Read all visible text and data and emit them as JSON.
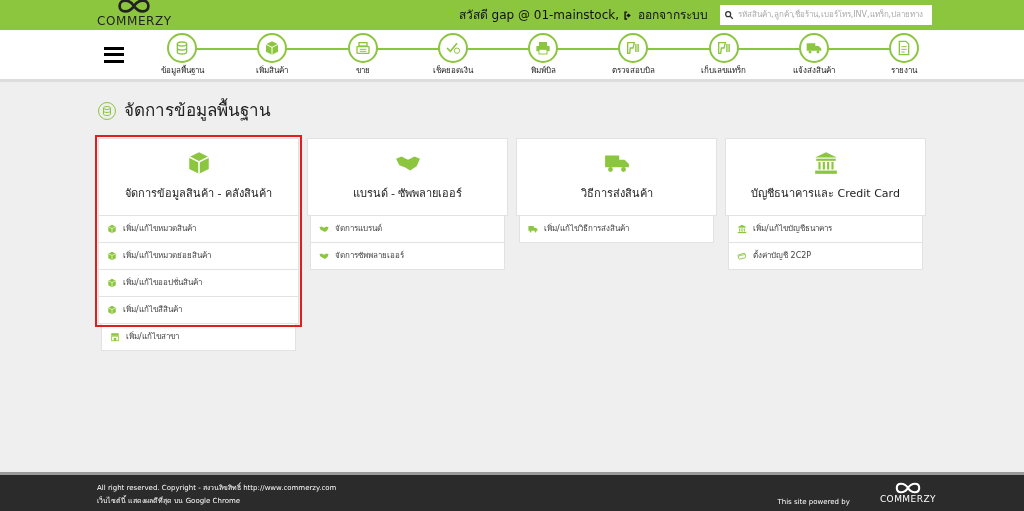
{
  "header": {
    "logo_text": "COMMERZY",
    "greeting": "สวัสดี gap @ 01-mainstock,",
    "logout": "ออกจากระบบ",
    "search": {
      "placeholder": "รหัสสินค้า,ลูกค้า,ชื่อร้าน,เบอร์โทร,INV,แทร็ก,ปลายทาง"
    }
  },
  "nav": {
    "steps": [
      {
        "label": "ข้อมูลพื้นฐาน",
        "kind": "database"
      },
      {
        "label": "เพิ่มสินค้า",
        "kind": "box"
      },
      {
        "label": "ขาย",
        "kind": "register"
      },
      {
        "label": "เช็คยอดเงิน",
        "kind": "check"
      },
      {
        "label": "พิมพ์บิล",
        "kind": "printer"
      },
      {
        "label": "ตรวจสอบบิล",
        "kind": "scanner"
      },
      {
        "label": "เก็บเลขแทร็ก",
        "kind": "scanner"
      },
      {
        "label": "แจ้งส่งสินค้า",
        "kind": "truck"
      },
      {
        "label": "รายงาน",
        "kind": "report"
      }
    ]
  },
  "page_title": "จัดการข้อมูลพื้นฐาน",
  "cards": [
    {
      "title": "จัดการข้อมูลสินค้า - คลังสินค้า",
      "kind": "box",
      "highlighted": true,
      "items": [
        {
          "label": "เพิ่ม/แก้ไขหมวดสินค้า",
          "kind": "box",
          "highlighted": true
        },
        {
          "label": "เพิ่ม/แก้ไขหมวดย่อยสินค้า",
          "kind": "box",
          "highlighted": true
        },
        {
          "label": "เพิ่ม/แก้ไขออปชั่นสินค้า",
          "kind": "box",
          "highlighted": true
        },
        {
          "label": "เพิ่ม/แก้ไขสีสินค้า",
          "kind": "box",
          "highlighted": true
        },
        {
          "label": "เพิ่ม/แก้ไขสาขา",
          "kind": "store",
          "highlighted": false
        }
      ]
    },
    {
      "title": "แบรนด์ - ซัพพลายเออร์",
      "kind": "handshake",
      "highlighted": false,
      "items": [
        {
          "label": "จัดการแบรนด์",
          "kind": "handshake",
          "highlighted": false
        },
        {
          "label": "จัดการซัพพลายเออร์",
          "kind": "handshake",
          "highlighted": false
        }
      ]
    },
    {
      "title": "วิธีการส่งสินค้า",
      "kind": "truck",
      "highlighted": false,
      "items": [
        {
          "label": "เพิ่ม/แก้ไขวิธีการส่งสินค้า",
          "kind": "truck",
          "highlighted": false
        }
      ]
    },
    {
      "title": "บัญชีธนาคารและ Credit Card",
      "kind": "bank",
      "highlighted": false,
      "items": [
        {
          "label": "เพิ่ม/แก้ไขบัญชีธนาคาร",
          "kind": "bank",
          "highlighted": false
        },
        {
          "label": "ตั้งค่าบัญชี 2C2P",
          "kind": "card",
          "highlighted": false
        }
      ]
    }
  ],
  "footer": {
    "lines": [
      "All right reserved. Copyright - สงวนลิขสิทธิ์ http://www.commerzy.com",
      "เว็บไซต์นี้ แสดงผลดีที่สุด บน Google Chrome"
    ],
    "powered_by": "This site powered by",
    "logo_text": "COMMERZY"
  }
}
